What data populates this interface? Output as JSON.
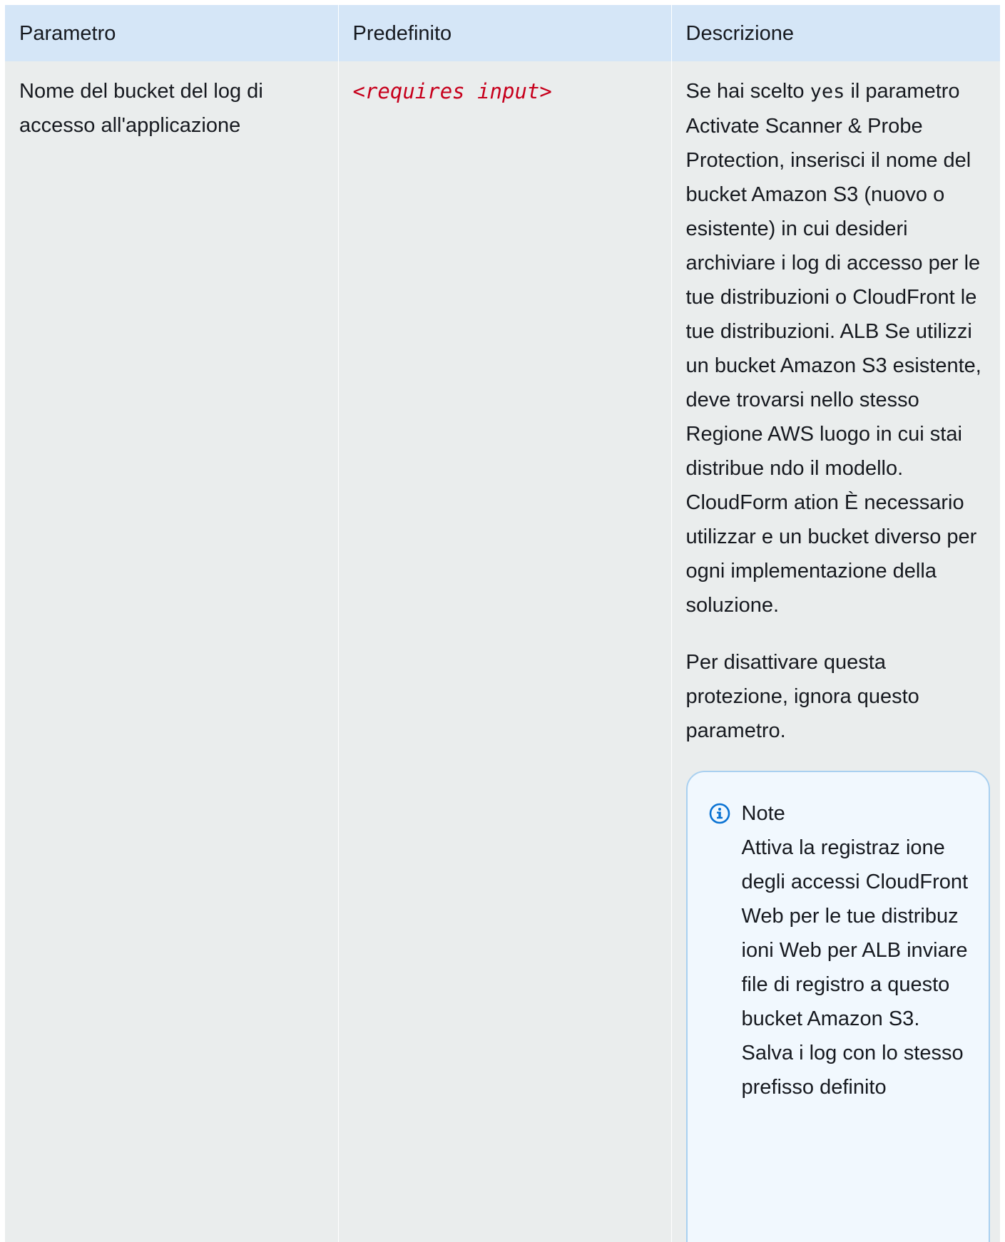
{
  "table": {
    "headers": {
      "parameter": "Parametro",
      "default": "Predefinito",
      "description": "Descrizione"
    },
    "row": {
      "parameter": "Nome del bucket del log di accesso all'applicazione",
      "default": "<requires input>",
      "description": {
        "p1_before": "Se hai scelto ",
        "p1_code": "yes",
        "p1_after": " il parametro Activate Scanner & Probe Protection, inserisci il nome del bucket Amazon S3 (nuovo o esistente) in cui desideri archiviare i log di accesso per le tue distribuzioni o CloudFront le tue distribuzioni. ALB Se utilizzi un bucket Amazon S3 esistente, deve trovarsi nello stesso Regione AWS luogo in cui stai distribue ndo il modello. CloudForm ation È necessario utilizzar e un bucket diverso per ogni implementazione della soluzione.",
        "p2": "Per disattivare questa protezione, ignora questo parametro.",
        "note": {
          "title": "Note",
          "icon": "info-icon",
          "body": "Attiva la registraz ione degli accessi CloudFront Web per le tue distribuz ioni Web per ALB inviare file di registro a questo bucket Amazon S3. Salva i log con lo stesso prefisso definito"
        }
      }
    }
  },
  "colors": {
    "header_bg": "#d5e6f7",
    "cell_bg": "#eaeded",
    "code_default": "#c7001c",
    "note_bg": "#f1f8fe",
    "note_border": "#a9d0f0",
    "info_icon": "#0972d3"
  }
}
